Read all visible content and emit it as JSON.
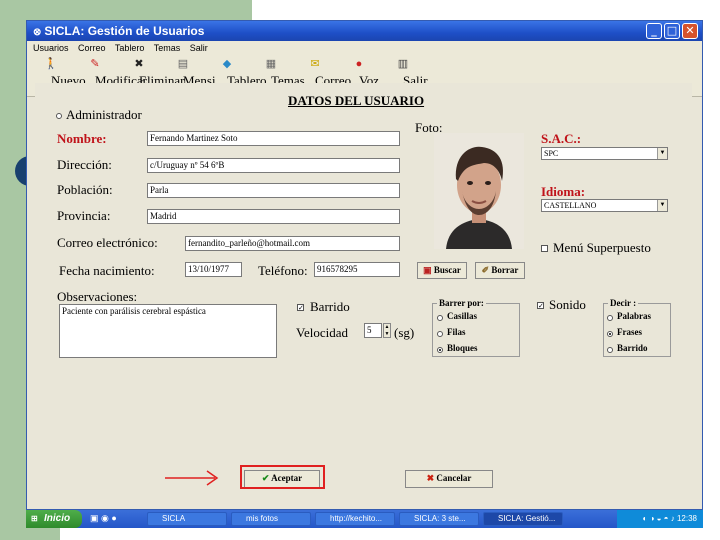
{
  "window": {
    "title": "SICLA: Gestión de Usuarios",
    "controls": {
      "minimize": "_",
      "maximize": "□",
      "close": "✕"
    }
  },
  "menu": [
    "Usuarios",
    "Correo",
    "Tablero",
    "Temas",
    "Salir"
  ],
  "toolbar": [
    {
      "label": "Nuevo",
      "icon": "new-user-icon"
    },
    {
      "label": "Modificar",
      "icon": "edit-user-icon"
    },
    {
      "label": "Eliminar",
      "icon": "delete-user-icon"
    },
    {
      "label": "Mensj",
      "icon": "message-icon"
    },
    {
      "label": "Tablero",
      "icon": "board-icon"
    },
    {
      "label": "Temas",
      "icon": "topics-icon"
    },
    {
      "label": "Correo",
      "icon": "mail-icon"
    },
    {
      "label": "Voz",
      "icon": "voice-icon"
    },
    {
      "label": "Salir",
      "icon": "exit-icon"
    }
  ],
  "form": {
    "heading": "DATOS DEL USUARIO",
    "admin_label": "Administrador",
    "name_label": "Nombre:",
    "name_value": "Fernando Martinez Soto",
    "address_label": "Dirección:",
    "address_value": "c/Uruguay nº 54 6ºB",
    "town_label": "Población:",
    "town_value": "Parla",
    "province_label": "Provincia:",
    "province_value": "Madrid",
    "email_label": "Correo electrónico:",
    "email_value": "fernandito_parleño@hotmail.com",
    "birth_label": "Fecha nacimiento:",
    "birth_value": "13/10/1977",
    "phone_label": "Teléfono:",
    "phone_value": "916578295",
    "notes_label": "Observaciones:",
    "notes_value": "Paciente con parálisis cerebral espástica",
    "photo_label": "Foto:",
    "sac_label": "S.A.C.:",
    "sac_value": "SPC",
    "language_label": "Idioma:",
    "language_value": "CASTELLANO",
    "menu_label": "Menú Superpuesto",
    "browse_button": "Buscar",
    "clear_button": "Borrar",
    "sweep_label": "Barrido",
    "speed_label": "Velocidad",
    "speed_value": "5",
    "speed_unit": "(sg)",
    "sweep_by_title": "Barrer por:",
    "sweep_by_options": [
      "Casillas",
      "Filas",
      "Bloques"
    ],
    "sound_label": "Sonido",
    "say_title": "Decir :",
    "say_options": [
      "Palabras",
      "Frases",
      "Barrido"
    ],
    "accept_button": "Aceptar",
    "cancel_button": "Cancelar"
  },
  "taskbar": {
    "start": "Inicio",
    "tasks": [
      "SICLA",
      "mis fotos",
      "http://kechito...",
      "SICLA: 3 ste...",
      "SICLA: Gestió..."
    ],
    "clock": "12:38"
  }
}
